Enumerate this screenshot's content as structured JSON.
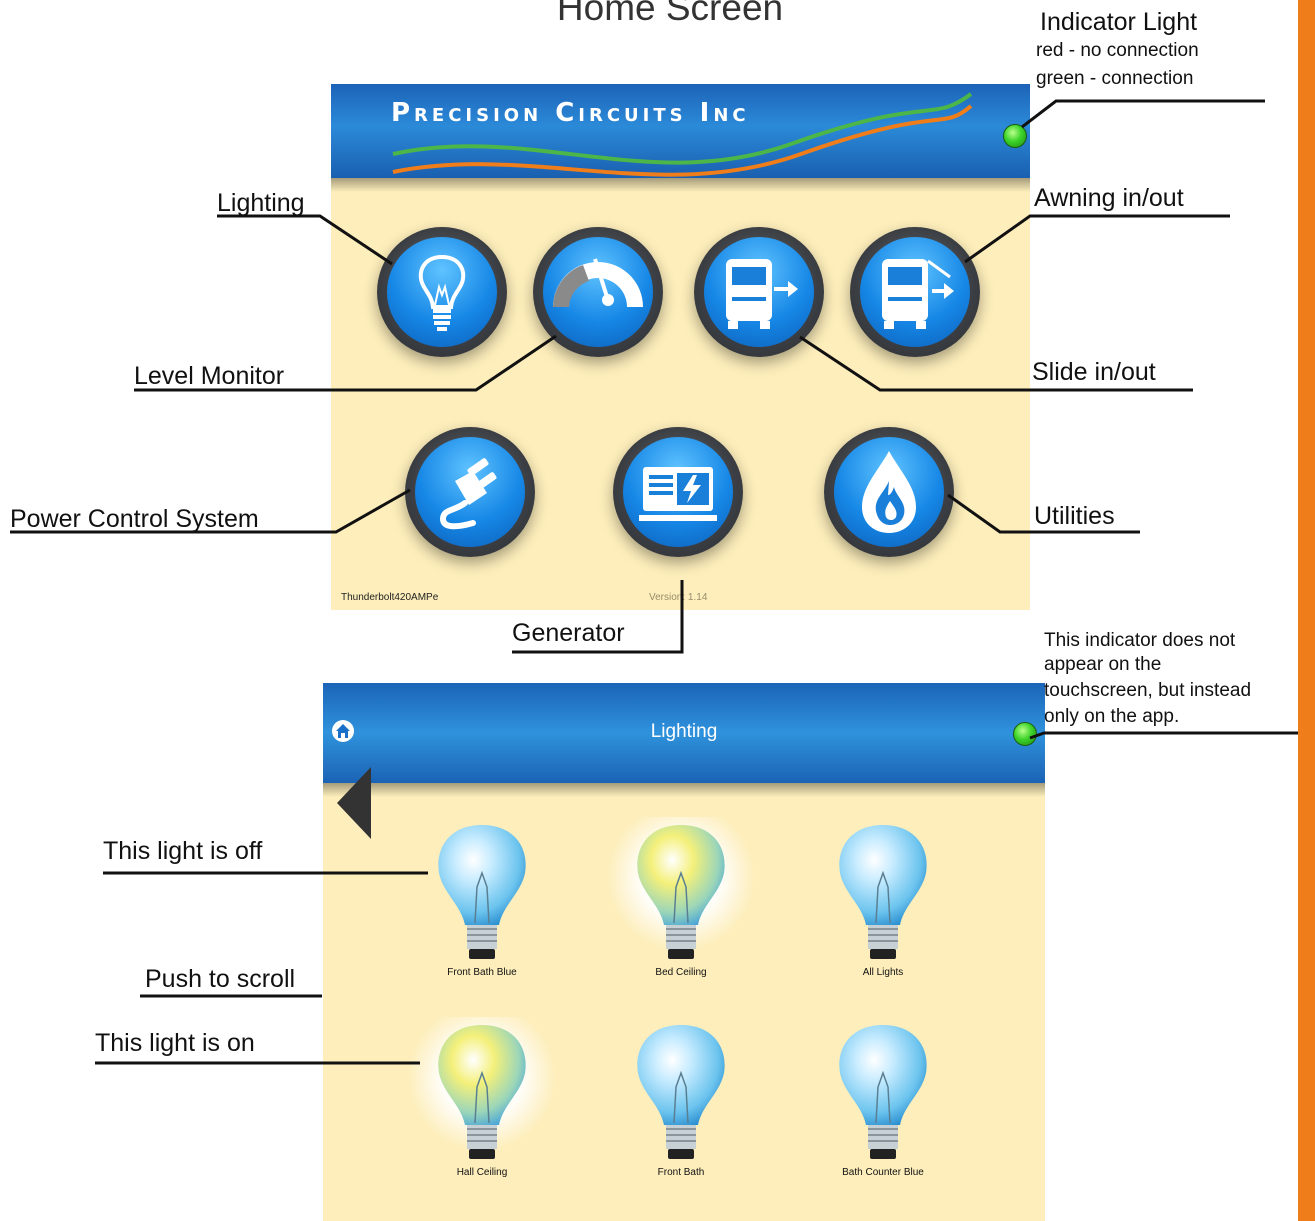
{
  "page_title": "Home Screen",
  "annotations": {
    "indicator_title": "Indicator Light",
    "indicator_red": "red - no connection",
    "indicator_green": "green - connection",
    "lighting": "Lighting",
    "awning": "Awning in/out",
    "level_monitor": "Level Monitor",
    "slide": "Slide in/out",
    "power_control": "Power Control System",
    "utilities": "Utilities",
    "generator": "Generator",
    "app_indicator_1": "This indicator does not",
    "app_indicator_2": "appear on the",
    "app_indicator_3": "touchscreen, but instead",
    "app_indicator_4": "only on the app.",
    "light_off": "This light is off",
    "push_scroll": "Push to scroll",
    "light_on": "This light is on"
  },
  "home_screen": {
    "brand": "Precision Circuits Inc",
    "connection_status": "connected",
    "indicator_color": "#3cd32a",
    "buttons": [
      {
        "name": "Lighting",
        "icon": "lightbulb-icon"
      },
      {
        "name": "Level Monitor",
        "icon": "gauge-icon"
      },
      {
        "name": "Slide in/out",
        "icon": "rv-slide-icon"
      },
      {
        "name": "Awning in/out",
        "icon": "rv-awning-icon"
      },
      {
        "name": "Power Control System",
        "icon": "power-plug-icon"
      },
      {
        "name": "Generator",
        "icon": "generator-icon"
      },
      {
        "name": "Utilities",
        "icon": "flame-drop-icon"
      }
    ],
    "model": "Thunderbolt420AMPe",
    "version": "Version: 1.14"
  },
  "lighting_screen": {
    "title": "Lighting",
    "lights": [
      {
        "label": "Front Bath Blue",
        "on": false
      },
      {
        "label": "Bed Ceiling",
        "on": true
      },
      {
        "label": "All Lights",
        "on": false
      },
      {
        "label": "Hall Ceiling",
        "on": true
      },
      {
        "label": "Front Bath",
        "on": false
      },
      {
        "label": "Bath Counter Blue",
        "on": false
      }
    ]
  }
}
